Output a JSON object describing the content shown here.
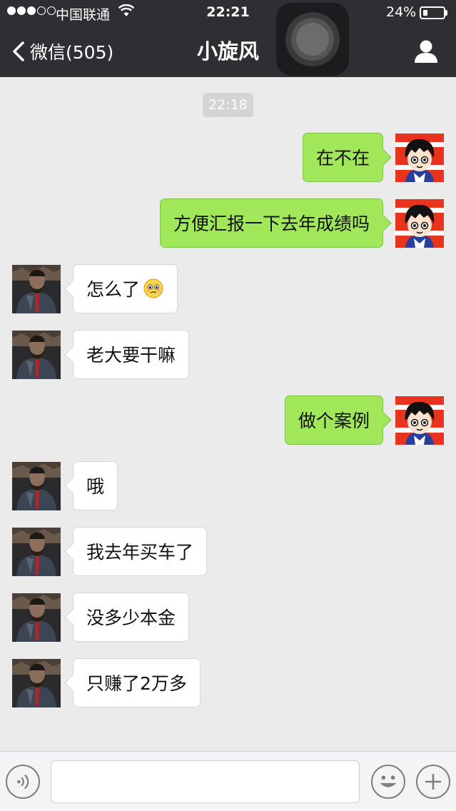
{
  "status_bar": {
    "carrier": "中国联通",
    "time": "22:21",
    "battery_percent": "24%",
    "battery_level": 0.24,
    "signal_bars_filled": 3,
    "signal_bars_total": 5
  },
  "nav": {
    "back_label": "微信(505)",
    "title": "小旋风"
  },
  "chat": {
    "timestamp": "22:18",
    "messages": [
      {
        "direction": "outgoing",
        "text": "在不在"
      },
      {
        "direction": "outgoing",
        "text": "方便汇报一下去年成绩吗"
      },
      {
        "direction": "incoming",
        "text": "怎么了",
        "emoji": "pleading-face-icon"
      },
      {
        "direction": "incoming",
        "text": "老大要干嘛"
      },
      {
        "direction": "outgoing",
        "text": "做个案例"
      },
      {
        "direction": "incoming",
        "text": "哦"
      },
      {
        "direction": "incoming",
        "text": "我去年买车了"
      },
      {
        "direction": "incoming",
        "text": "没多少本金"
      },
      {
        "direction": "incoming",
        "text": "只赚了2万多"
      }
    ]
  },
  "input_bar": {
    "message_value": "",
    "icons": [
      "voice-icon",
      "emoji-icon",
      "plus-icon"
    ]
  },
  "colors": {
    "nav_bg": "#2f2f33",
    "chat_bg": "#ebebeb",
    "outgoing_bubble": "#a0e75a",
    "incoming_bubble": "#ffffff"
  }
}
